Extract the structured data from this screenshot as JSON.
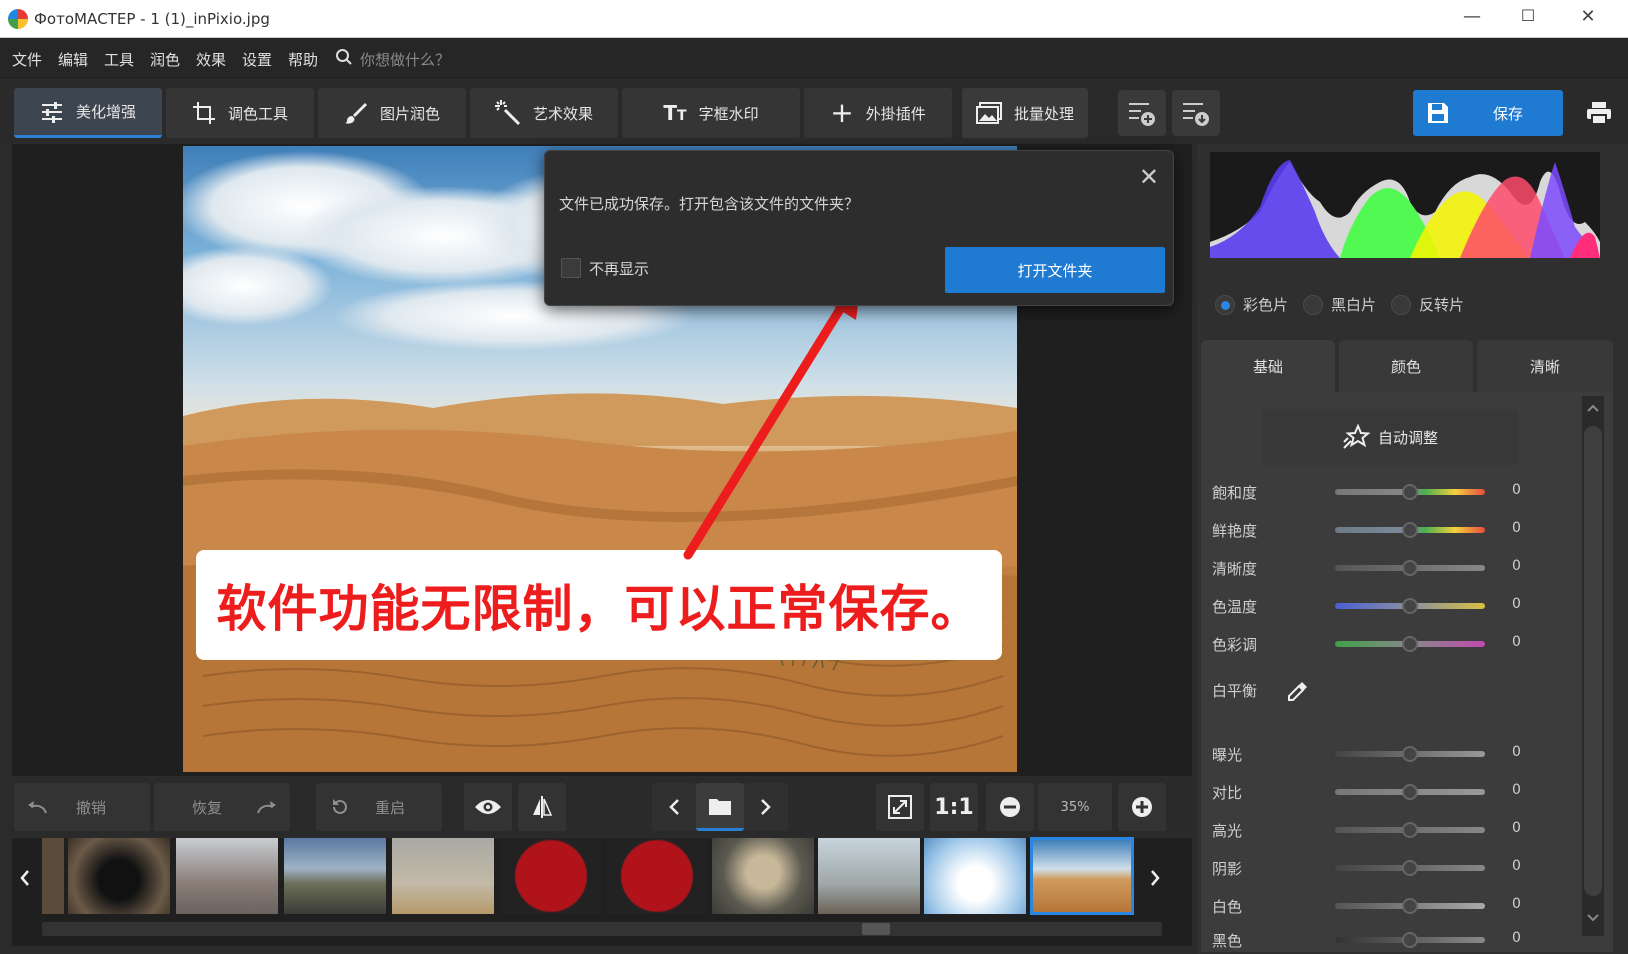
{
  "window": {
    "title": "ФотоМАСТЕР - 1 (1)_inPixio.jpg",
    "controls": {
      "minimize": "—",
      "maximize": "☐",
      "close": "✕"
    }
  },
  "menu": {
    "items": [
      "文件",
      "编辑",
      "工具",
      "润色",
      "效果",
      "设置",
      "帮助"
    ],
    "search_placeholder": "你想做什么？"
  },
  "toolbar": {
    "tabs": [
      {
        "label": "美化增强",
        "icon": "sliders-icon",
        "active": true
      },
      {
        "label": "调色工具",
        "icon": "crop-icon"
      },
      {
        "label": "图片润色",
        "icon": "brush-icon"
      },
      {
        "label": "艺术效果",
        "icon": "magic-wand-icon"
      },
      {
        "label": "字框水印",
        "icon": "text-icon"
      },
      {
        "label": "外掛插件",
        "icon": "plus-icon"
      },
      {
        "label": "批量处理",
        "icon": "images-icon"
      }
    ],
    "save_label": "保存"
  },
  "dialog": {
    "message": "文件已成功保存。打开包含该文件的文件夹？",
    "dont_show_label": "不再显示",
    "open_folder_label": "打开文件夹"
  },
  "callout": {
    "text": "软件功能无限制，可以正常保存。"
  },
  "bottombar": {
    "undo_label": "撤销",
    "redo_label": "恢复",
    "reset_label": "重启",
    "ratio_label": "1:1",
    "zoom_value": "35%"
  },
  "right_panel": {
    "modes": [
      {
        "label": "彩色片",
        "selected": true
      },
      {
        "label": "黑白片",
        "selected": false
      },
      {
        "label": "反转片",
        "selected": false
      }
    ],
    "tabs": [
      "基础",
      "颜色",
      "清晰"
    ],
    "auto_adjust_label": "自动调整",
    "sliders": [
      {
        "label": "飽和度",
        "value": "0"
      },
      {
        "label": "鲜艳度",
        "value": "0"
      },
      {
        "label": "清晰度",
        "value": "0"
      },
      {
        "label": "色温度",
        "value": "0"
      },
      {
        "label": "色彩调",
        "value": "0"
      }
    ],
    "white_balance_label": "白平衡",
    "sliders2": [
      {
        "label": "曝光",
        "value": "0"
      },
      {
        "label": "对比",
        "value": "0"
      },
      {
        "label": "高光",
        "value": "0"
      },
      {
        "label": "阴影",
        "value": "0"
      },
      {
        "label": "白色",
        "value": "0"
      },
      {
        "label": "黑色",
        "value": "0"
      }
    ]
  },
  "colors": {
    "accent": "#1f7ad1",
    "callout_text": "#ee1d1d",
    "arrow": "#ee1d1d"
  }
}
